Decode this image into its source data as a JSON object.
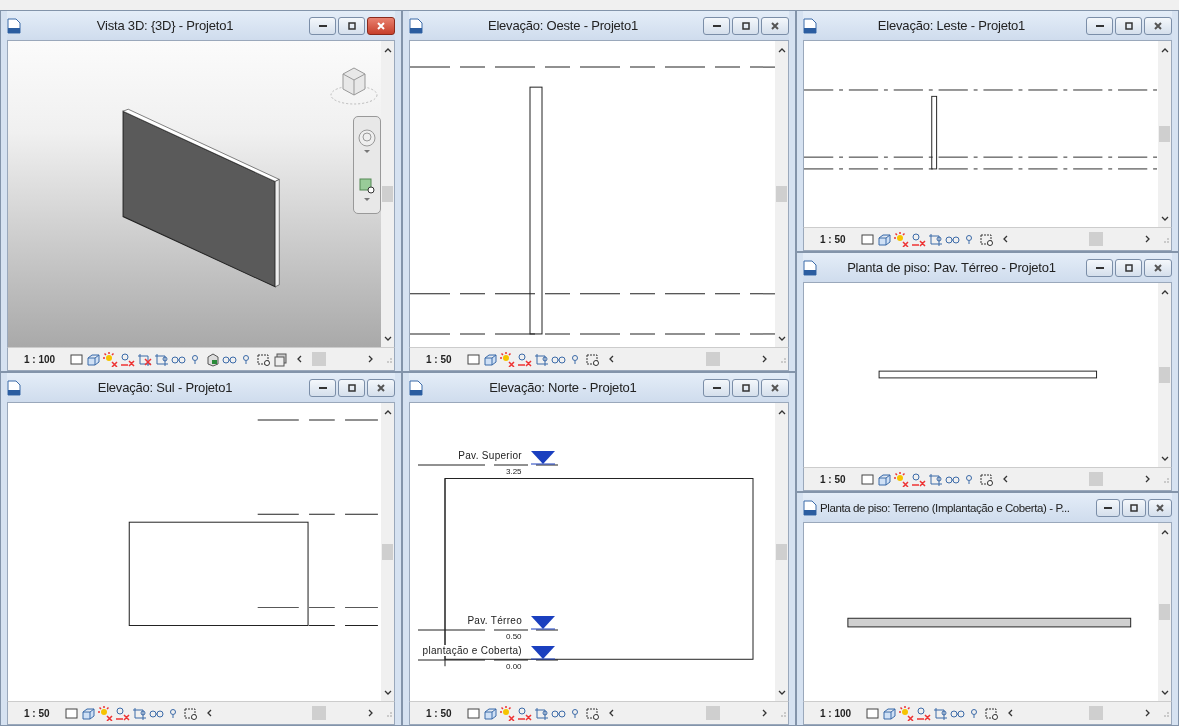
{
  "windows": [
    {
      "title": "Vista 3D: {3D} - Projeto1",
      "active": true,
      "kind": "perspective",
      "scale": "1 : 100"
    },
    {
      "title": "Elevação: Sul - Projeto1",
      "active": false,
      "kind": "south",
      "scale": "1 : 50"
    },
    {
      "title": "Elevação: Oeste - Projeto1",
      "active": false,
      "kind": "west",
      "scale": "1 : 50"
    },
    {
      "title": "Elevação: Norte - Projeto1",
      "active": false,
      "kind": "north",
      "scale": "1 : 50",
      "levels": [
        {
          "name": "Pav. Superior",
          "value": "3.25"
        },
        {
          "name": "Pav. Térreo",
          "value": "0.50"
        },
        {
          "name": "plantação e Coberta)",
          "value": "0.00"
        }
      ]
    },
    {
      "title": "Elevação: Leste - Projeto1",
      "active": false,
      "kind": "east",
      "scale": "1 : 50"
    },
    {
      "title": "Planta de piso: Pav. Térreo - Projeto1",
      "active": false,
      "kind": "plan",
      "scale": "1 : 50"
    },
    {
      "title": "Planta de piso: Terreno (Implantação e Coberta) - P...",
      "active": false,
      "kind": "site",
      "scale": "1 : 100"
    }
  ]
}
